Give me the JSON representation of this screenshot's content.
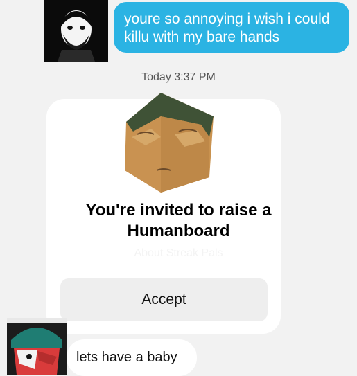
{
  "conversation": {
    "outgoing_message": "youre so annoying i wish i could killu with my bare hands",
    "timestamp": "Today 3:37 PM",
    "incoming_message": "lets have a baby"
  },
  "invite_card": {
    "title_line1": "You're invited to raise a",
    "title_line2": "Humanboard",
    "faded_text": "About Streak Pals",
    "accept_label": "Accept"
  },
  "colors": {
    "outgoing_bubble": "#2bb3e3",
    "background": "#f2f2f2",
    "button": "#eeeeee"
  },
  "icons": {
    "sender_avatar": "bearded-man-avatar-icon",
    "mascot": "humanboard-face-icon",
    "recipient_avatar": "helmet-character-avatar-icon"
  }
}
